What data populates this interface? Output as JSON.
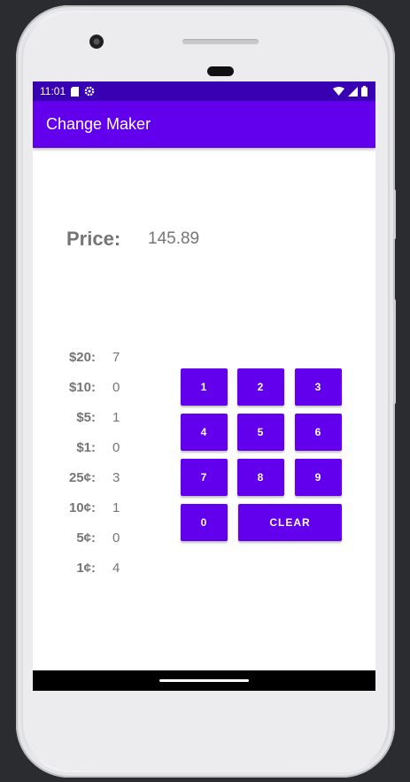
{
  "status_bar": {
    "time": "11:01",
    "icons": [
      "sim-card-icon",
      "settings-icon",
      "wifi-icon",
      "signal-icon",
      "battery-icon"
    ]
  },
  "app_bar": {
    "title": "Change Maker"
  },
  "price": {
    "label": "Price:",
    "value": "145.89"
  },
  "change": [
    {
      "denom": "$20:",
      "count": "7"
    },
    {
      "denom": "$10:",
      "count": "0"
    },
    {
      "denom": "$5:",
      "count": "1"
    },
    {
      "denom": "$1:",
      "count": "0"
    },
    {
      "denom": "25¢:",
      "count": "3"
    },
    {
      "denom": "10¢:",
      "count": "1"
    },
    {
      "denom": "5¢:",
      "count": "0"
    },
    {
      "denom": "1¢:",
      "count": "4"
    }
  ],
  "keypad": {
    "keys": [
      "1",
      "2",
      "3",
      "4",
      "5",
      "6",
      "7",
      "8",
      "9",
      "0"
    ],
    "clear_label": "CLEAR"
  },
  "colors": {
    "primary": "#6200ee",
    "primary_dark": "#3700b3",
    "text_gray": "#757575"
  }
}
